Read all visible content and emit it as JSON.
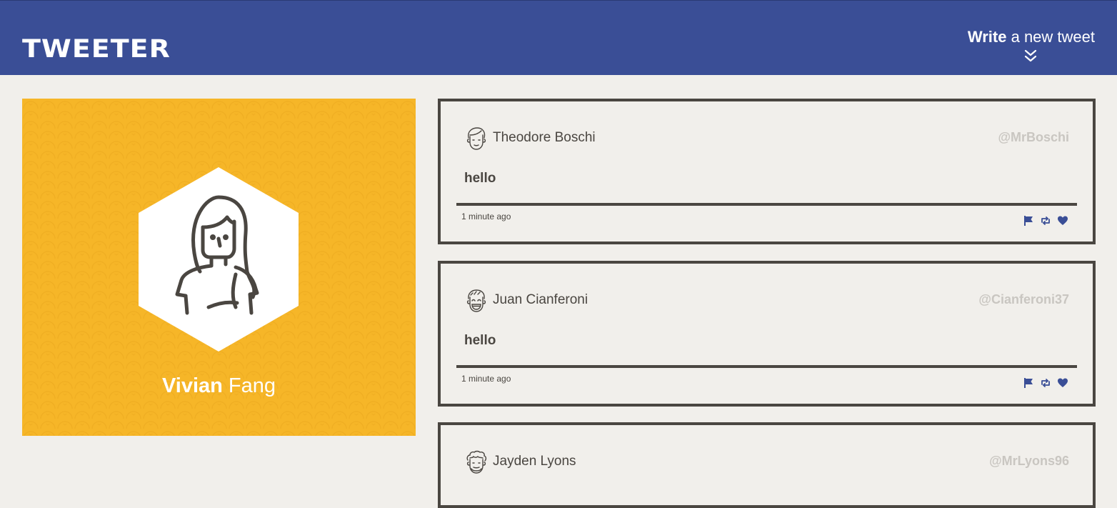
{
  "nav": {
    "brand": "TWEETER",
    "compose_bold": "Write",
    "compose_rest": "a new tweet",
    "compose_icon": "double-chevron-down-icon"
  },
  "profile": {
    "first_name": "Vivian",
    "last_name": "Fang",
    "avatar_icon": "woman-avatar-icon",
    "colors": {
      "background": "#f6b628",
      "hexagon": "#ffffff"
    }
  },
  "colors": {
    "nav": "#3a4e96",
    "page": "#f1efeb",
    "text": "#4a4641",
    "handle": "#c9c6c1",
    "action": "#3a4e96"
  },
  "tweets": [
    {
      "author": "Theodore Boschi",
      "handle": "@MrBoschi",
      "body": "hello",
      "time": "1 minute ago",
      "avatar_icon": "man-avatar-icon"
    },
    {
      "author": "Juan Cianferoni",
      "handle": "@Cianferoni37",
      "body": "hello",
      "time": "1 minute ago",
      "avatar_icon": "laughing-man-avatar-icon"
    },
    {
      "author": "Jayden Lyons",
      "handle": "@MrLyons96",
      "body": "",
      "time": "",
      "avatar_icon": "curly-hair-avatar-icon"
    }
  ],
  "actions": {
    "flag": "flag-icon",
    "retweet": "retweet-icon",
    "like": "heart-icon"
  }
}
